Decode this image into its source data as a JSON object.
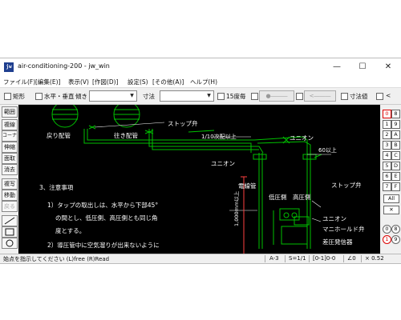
{
  "window": {
    "app_icon": "jw",
    "title": "air-conditioning-200 - jw_win",
    "controls": {
      "minimize": "—",
      "maximize": "☐",
      "close": "✕"
    }
  },
  "menu": [
    "ファイル(F)",
    "[編集(E)]",
    "表示(V)",
    "[作図(D)]",
    "設定(S)",
    "[その他(A)]",
    "ヘルプ(H)"
  ],
  "toolbar": {
    "rect_label": "矩形",
    "hv_label": "水平・垂直",
    "tilt_label": "傾き",
    "dim_label": "寸法",
    "deg_label": "15度毎",
    "btn_dash1": "●―――",
    "btn_dash2": "<―――",
    "dimval_label": "寸法値",
    "lt_label": "<"
  },
  "left_tools": [
    "範囲",
    "複線",
    "コーナー",
    "伸縮",
    "面取",
    "消去",
    "複写",
    "移動",
    "戻る"
  ],
  "right_tools": {
    "left": [
      "0",
      "1",
      "2",
      "3",
      "4",
      "5",
      "6",
      "7"
    ],
    "right": [
      "8",
      "9",
      "A",
      "B",
      "C",
      "D",
      "E",
      "F"
    ],
    "all": "All",
    "x": "✕",
    "circle0": "0",
    "circle1": "1",
    "circle8": "8",
    "circle9": "9"
  },
  "drawing": {
    "label_return_pipe": "戻り配管",
    "label_supply_pipe": "往き配管",
    "label_stop_valve_1": "ストップ弁",
    "label_slope": "1/10次配以上",
    "label_union_1": "ユニオン",
    "label_union_2": "ユニオン",
    "label_60": "60以上",
    "label_power_line": "電線管",
    "label_low_side": "低圧側",
    "label_high_side": "高圧側",
    "label_stop_valve_2": "ストップ弁",
    "label_union_3": "ユニオン",
    "label_manifold": "マニホールド弁",
    "label_pressure_gen": "差圧発信器",
    "label_1000": "1,000mm以上",
    "notes_heading": "3、注意事項",
    "note_1a": "1）タップの取出しは、水平から下部45°",
    "note_1b": "の間とし、低圧側、高圧側とも同じ角",
    "note_1c": "度とする。",
    "note_2a": "2）導圧管中に空気溜りが出来ないように"
  },
  "status": {
    "message": "始点を指示してください (L)free (R)Read",
    "paper": "A-3",
    "scale": "S=1/1",
    "layer": "[0-1]0-0",
    "angle": "∠0",
    "zoom": "× 0.52"
  },
  "colors": {
    "canvas_bg": "#000000",
    "pipe": "#00c000",
    "text": "#ffffff",
    "dim": "#ff4040",
    "accent": "#1f3f8f"
  }
}
